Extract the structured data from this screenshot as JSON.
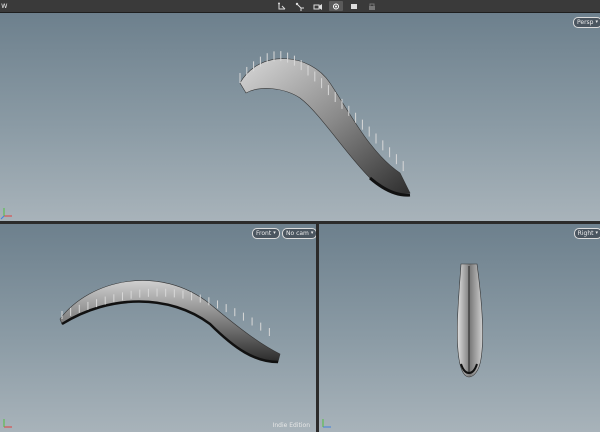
{
  "toolbar": {
    "left_fragment": "w",
    "tools": [
      {
        "icon": "handle-tool-icon"
      },
      {
        "icon": "snap-tool-icon"
      },
      {
        "icon": "camera-tool-icon"
      },
      {
        "icon": "view-tool-icon",
        "active": true
      },
      {
        "icon": "display-icon"
      },
      {
        "icon": "lock-icon"
      }
    ]
  },
  "viewports": {
    "persp": {
      "camera_label": "Persp"
    },
    "front": {
      "view_label": "Front",
      "camera_label": "No cam"
    },
    "right": {
      "view_label": "Right"
    }
  },
  "edition_label": "Indie Edition",
  "colors": {
    "toolbar_bg": "#3a3a3a",
    "viewport_top": "#6d808d",
    "viewport_bottom": "#a8b3ba",
    "axis_x": "#e04040",
    "axis_y": "#50c040",
    "axis_z": "#4080e0"
  }
}
